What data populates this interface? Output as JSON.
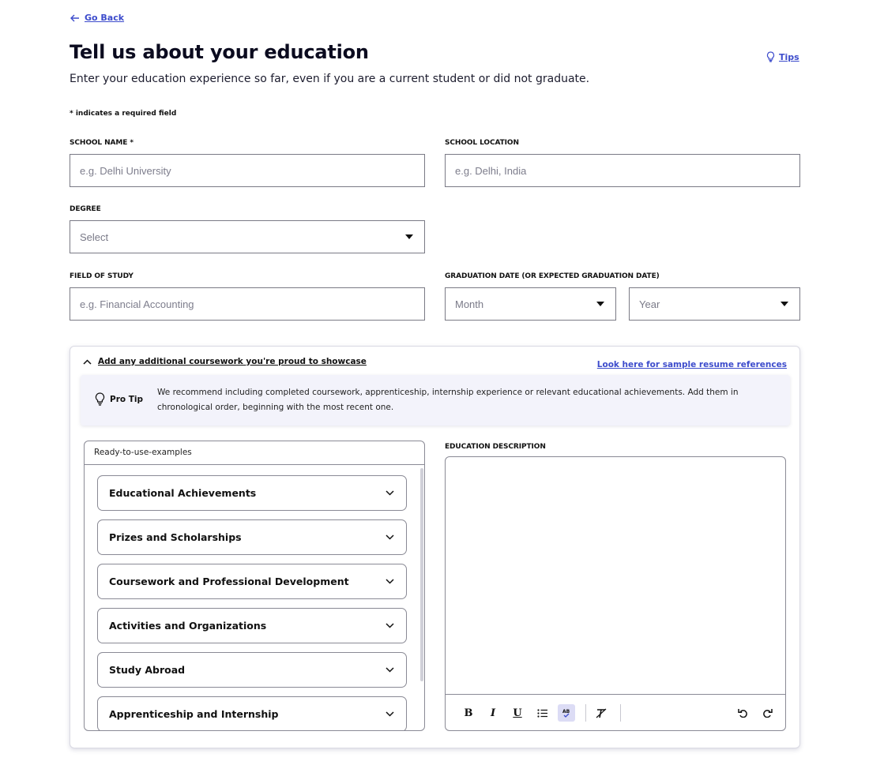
{
  "nav": {
    "go_back": "Go Back",
    "tips": "Tips"
  },
  "header": {
    "title": "Tell us about your education",
    "subtitle": "Enter your education experience so far, even if you are a current student or did not graduate."
  },
  "form": {
    "required_note": "* indicates a required field",
    "school_name": {
      "label": "SCHOOL NAME *",
      "placeholder": "e.g. Delhi University",
      "value": ""
    },
    "school_location": {
      "label": "SCHOOL LOCATION",
      "placeholder": "e.g. Delhi, India",
      "value": ""
    },
    "degree": {
      "label": "DEGREE",
      "selected": "Select"
    },
    "field_of_study": {
      "label": "FIELD OF STUDY",
      "placeholder": "e.g. Financial Accounting",
      "value": ""
    },
    "graduation": {
      "label": "GRADUATION DATE (OR EXPECTED GRADUATION DATE)",
      "month": "Month",
      "year": "Year"
    }
  },
  "coursework": {
    "toggle_label": "Add any additional coursework you're proud to showcase",
    "samples_link": "Look here for sample resume references",
    "pro_tip": {
      "title": "Pro Tip",
      "text": "We recommend including completed coursework, apprenticeship, internship experience or relevant educational achievements. Add them in chronological order, beginning with the most recent one."
    },
    "examples": {
      "header": "Ready-to-use-examples",
      "items": [
        "Educational Achievements",
        "Prizes and Scholarships",
        "Coursework and Professional Development",
        "Activities and Organizations",
        "Study Abroad",
        "Apprenticeship and Internship"
      ]
    },
    "description": {
      "label": "EDUCATION DESCRIPTION",
      "toolbar": [
        "bold",
        "italic",
        "underline",
        "bullet-list",
        "spellcheck",
        "clear-format",
        "undo",
        "redo"
      ]
    }
  },
  "colors": {
    "accent": "#3d4ccc",
    "protip_bg": "#f3f3fb",
    "border": "#8a8a95"
  }
}
